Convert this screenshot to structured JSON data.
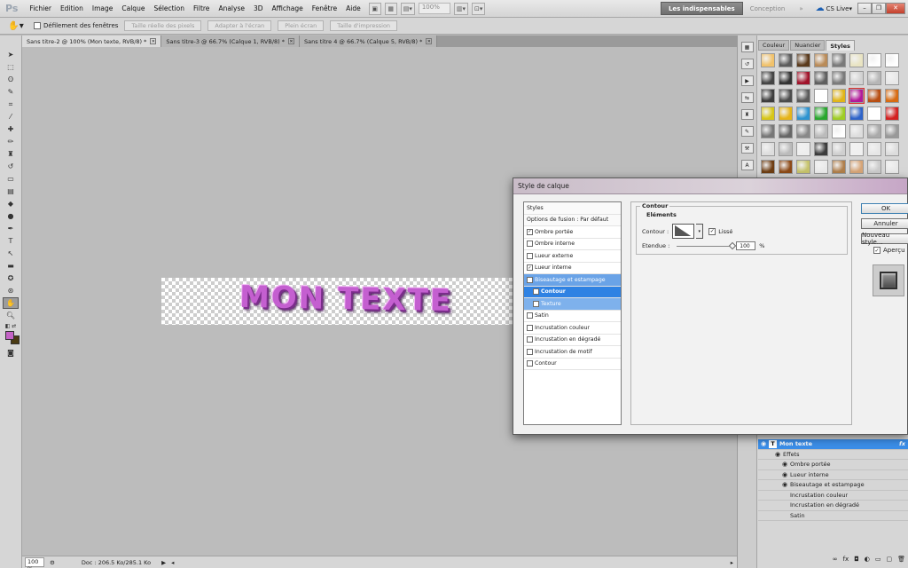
{
  "app": {
    "logo": "Ps"
  },
  "menu": [
    "Fichier",
    "Edition",
    "Image",
    "Calque",
    "Sélection",
    "Filtre",
    "Analyse",
    "3D",
    "Affichage",
    "Fenêtre",
    "Aide"
  ],
  "menubar": {
    "zoom_value": "100%",
    "workspace_active": "Les indispensables",
    "workspace_other": "Conception",
    "more": "»",
    "cs_live": "CS Live",
    "cs_live_arrow": "▾"
  },
  "options": {
    "scroll_all_windows": "Défilement des fenêtres",
    "buttons": [
      "Taille réelle des pixels",
      "Adapter à l'écran",
      "Plein écran",
      "Taille d'impression"
    ]
  },
  "tabs": [
    {
      "label": "Sans titre-2 @ 100% (Mon texte, RVB/8) *"
    },
    {
      "label": "Sans titre-3 @ 66.7% (Calque 1, RVB/8) *"
    },
    {
      "label": "Sans titre 4 @ 66.7% (Calque 5, RVB/8) *"
    }
  ],
  "canvas": {
    "text": "MON TEXTE",
    "fg_color": "#c463c6",
    "bg_color": "#4a3a12"
  },
  "status": {
    "zoom": "100 %",
    "doc": "Doc : 206.5 Ko/285.1 Ko"
  },
  "panel": {
    "tabs": [
      "Couleur",
      "Nuancier",
      "Styles"
    ],
    "active_tab": "Styles"
  },
  "layers": {
    "main": {
      "name": "Mon texte",
      "fx": "fx"
    },
    "effects_label": "Effets",
    "effects": [
      {
        "label": "Ombre portée",
        "visible": true
      },
      {
        "label": "Lueur interne",
        "visible": true
      },
      {
        "label": "Biseautage et estampage",
        "visible": true
      },
      {
        "label": "Incrustation couleur",
        "visible": false
      },
      {
        "label": "Incrustation en dégradé",
        "visible": false
      },
      {
        "label": "Satin",
        "visible": false
      }
    ]
  },
  "dialog": {
    "title": "Style de calque",
    "styles_header": "Styles",
    "blend_options": "Options de fusion : Par défaut",
    "items": [
      {
        "label": "Ombre portée",
        "checked": true
      },
      {
        "label": "Ombre interne",
        "checked": false
      },
      {
        "label": "Lueur externe",
        "checked": false
      },
      {
        "label": "Lueur interne",
        "checked": true
      },
      {
        "label": "Biseautage et estampage",
        "checked": true
      },
      {
        "label": "Contour",
        "checked": true
      },
      {
        "label": "Texture",
        "checked": false
      },
      {
        "label": "Satin",
        "checked": false
      },
      {
        "label": "Incrustation couleur",
        "checked": false
      },
      {
        "label": "Incrustation en dégradé",
        "checked": false
      },
      {
        "label": "Incrustation de motif",
        "checked": false
      },
      {
        "label": "Contour",
        "checked": false
      }
    ],
    "section_title": "Contour",
    "subsection": "Eléments",
    "contour_label": "Contour :",
    "smooth_label": "Lissé",
    "range_label": "Etendue :",
    "range_value": "100",
    "range_unit": "%",
    "buttons": {
      "ok": "OK",
      "cancel": "Annuler",
      "new_style": "Nouveau style..."
    },
    "preview_label": "Aperçu"
  }
}
